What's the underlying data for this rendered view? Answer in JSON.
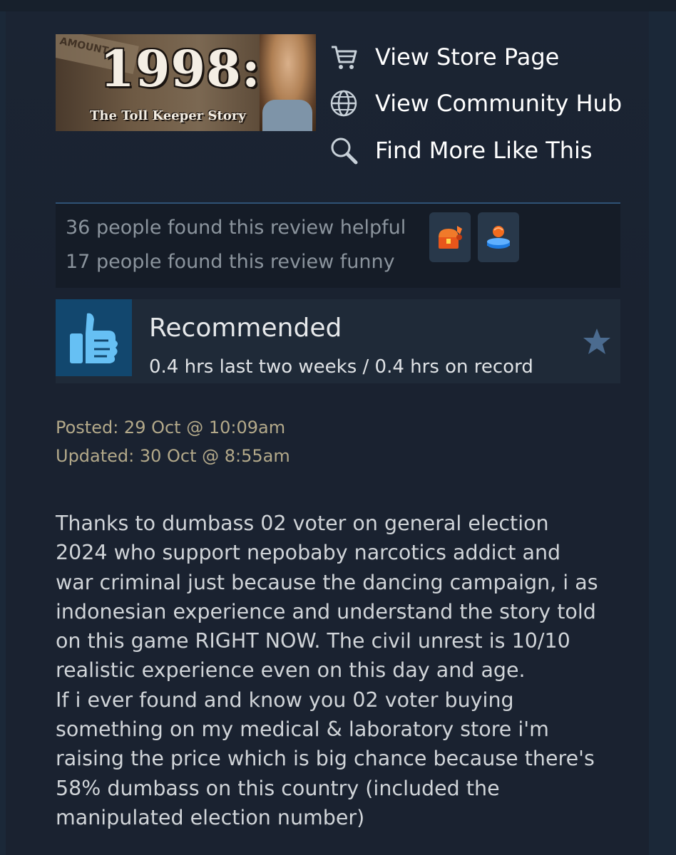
{
  "game": {
    "capsule_title": "1998:",
    "capsule_subtitle": "The Toll Keeper Story",
    "capsule_sign": "AMOUNT"
  },
  "links": [
    {
      "label": "View Store Page",
      "icon": "cart-icon"
    },
    {
      "label": "View Community Hub",
      "icon": "globe-icon"
    },
    {
      "label": "Find More Like This",
      "icon": "search-icon"
    }
  ],
  "helpful": {
    "helpful_text": "36 people found this review helpful",
    "funny_text": "17 people found this review funny",
    "awards": [
      "treasure-chest-award-icon",
      "boxing-glove-award-icon"
    ]
  },
  "recommendation": {
    "verdict": "Recommended",
    "hours": "0.4 hrs last two weeks / 0.4 hrs on record",
    "icon": "thumbs-up-icon"
  },
  "dates": {
    "posted": "Posted: 29 Oct @ 10:09am",
    "updated": "Updated: 30 Oct @ 8:55am"
  },
  "review_lines": [
    "Thanks to dumbass 02 voter on general election",
    "2024 who support nepobaby narcotics addict and",
    "war criminal just because the dancing campaign, i as",
    "indonesian experience and understand the story told",
    "on this game RIGHT NOW. The civil unrest is 10/10",
    "realistic experience even on this day and age.",
    "If i ever found and know you 02 voter buying",
    "something on my medical & laboratory store i'm",
    "raising the price which is big chance because there's",
    "58% dumbass on this country (included the",
    "manipulated election number)"
  ],
  "colors": {
    "background": "#1b2838",
    "accent_blue": "#12476e",
    "date_text": "#b3a98a"
  }
}
